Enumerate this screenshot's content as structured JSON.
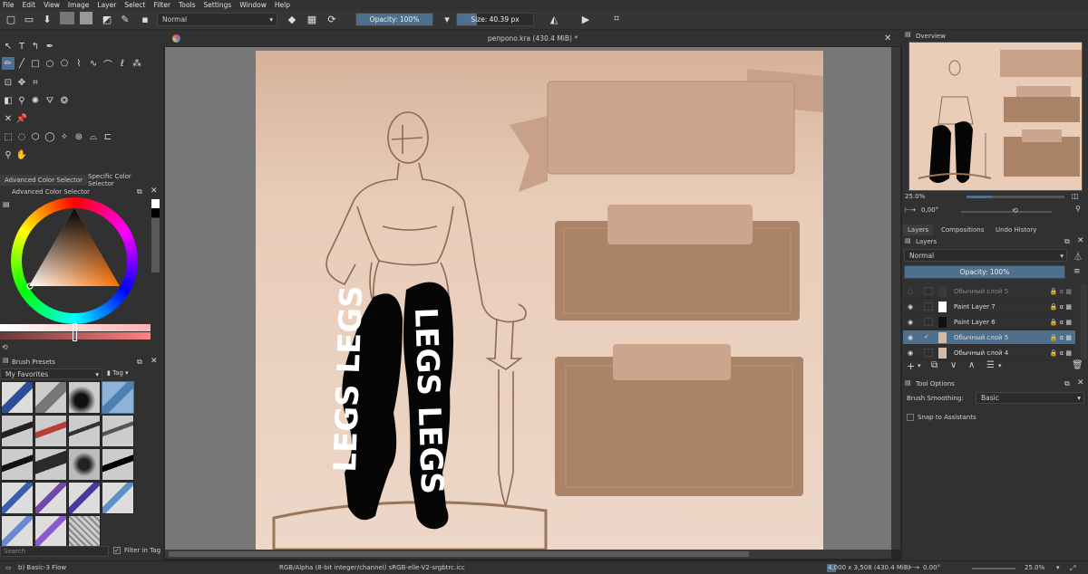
{
  "menu": [
    "File",
    "Edit",
    "View",
    "Image",
    "Layer",
    "Select",
    "Filter",
    "Tools",
    "Settings",
    "Window",
    "Help"
  ],
  "toolbar": {
    "blend_mode": "Normal",
    "opacity": "Opacity: 100%",
    "size": "Size: 40.39 px"
  },
  "document": {
    "tab_title": "репрono.kra (430.4 MiB) *",
    "canvas_text_left": "LEGS LEGS",
    "canvas_text_right": "LEGS LEGS"
  },
  "color_selector": {
    "tab_advanced": "Advanced Color Selector",
    "tab_specific": "Specific Color Selector",
    "title": "Advanced Color Selector"
  },
  "brush_presets": {
    "title": "Brush Presets",
    "favorites": "My Favorites",
    "tag": "Tag",
    "search_placeholder": "Search",
    "filter_label": "Filter in Tag"
  },
  "overview": {
    "title": "Overview",
    "zoom": "25.0%",
    "rotation": "0,00°"
  },
  "layers_panel": {
    "tabs": [
      "Layers",
      "Compositions",
      "Undo History"
    ],
    "title": "Layers",
    "blend_mode": "Normal",
    "opacity": "Opacity:  100%",
    "layers": [
      {
        "name": "Обычный слой 5",
        "visible": false
      },
      {
        "name": "Paint Layer 7",
        "visible": true
      },
      {
        "name": "Paint Layer 6",
        "visible": true
      },
      {
        "name": "Обычный слой 5",
        "visible": true,
        "selected": true
      },
      {
        "name": "Обычный слой 4",
        "visible": true
      }
    ]
  },
  "tool_options": {
    "title": "Tool Options",
    "smoothing_label": "Brush Smoothing:",
    "smoothing_value": "Basic",
    "snap_label": "Snap to Assistants"
  },
  "status": {
    "brush": "b) Basic-3 Flow",
    "color_profile": "RGB/Alpha (8-bit integer/channel)  sRGB-elle-V2-srgbtrc.icc",
    "dimensions": "4,000 x 3,508 (430.4 MiB)",
    "rotation": "0.00°",
    "zoom": "25.0%"
  },
  "colors": {
    "accent": "#4f6f8f",
    "canvas_bg": "#e7c9b4",
    "banner": "#c49c80",
    "box_dark": "#a57d63"
  }
}
